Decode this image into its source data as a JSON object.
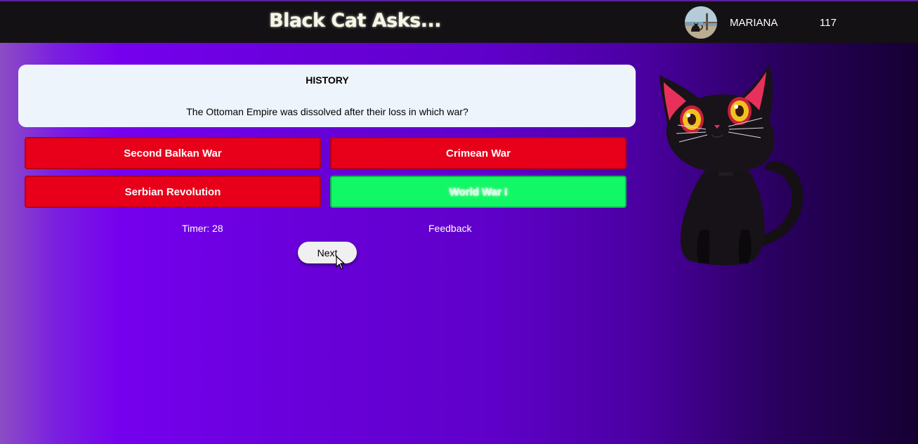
{
  "header": {
    "title": "Black Cat Asks...",
    "username": "MARIANA",
    "score": "117"
  },
  "question": {
    "category": "HISTORY",
    "text": "The Ottoman Empire was dissolved after their loss in which war?"
  },
  "answers": [
    {
      "label": "Second Balkan War",
      "state": "wrong"
    },
    {
      "label": "Crimean War",
      "state": "wrong"
    },
    {
      "label": "Serbian Revolution",
      "state": "wrong"
    },
    {
      "label": "World War I",
      "state": "correct"
    }
  ],
  "footer": {
    "timer": "Timer: 28",
    "feedback": "Feedback",
    "next_label": "Next"
  },
  "colors": {
    "wrong": "#e8001b",
    "correct": "#12f765",
    "card": "#eef4fb",
    "topbar": "#141114"
  },
  "icons": {
    "avatar": "user-avatar-photo",
    "mascot": "black-cat-mascot",
    "cursor": "mouse-pointer-icon"
  }
}
